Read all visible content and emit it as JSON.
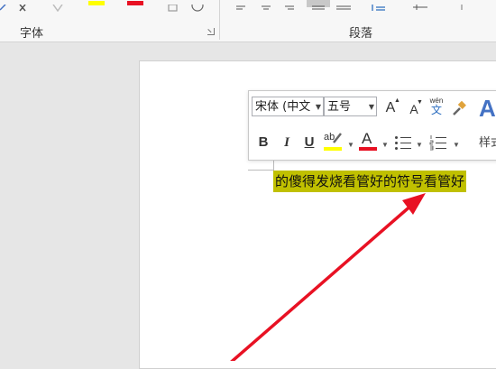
{
  "ribbon": {
    "font_group_label": "字体",
    "paragraph_group_label": "段落",
    "highlight_color": "#ffff00",
    "font_color": "#e81123"
  },
  "mini_toolbar": {
    "font_name": "宋体 (中文",
    "font_size": "五号",
    "grow_font_label": "A",
    "shrink_font_label": "A",
    "phonetic_top": "wén",
    "phonetic_bottom": "文",
    "styles_label": "样式",
    "bold_label": "B",
    "italic_label": "I",
    "underline_label": "U",
    "highlight_label": "ab",
    "font_color_label": "A",
    "highlight_color": "#ffff00",
    "font_color": "#e81123",
    "style_letter": "A"
  },
  "document": {
    "selected_text": "的傻得发烧看管好的符号看管好",
    "selection_color": "#c0c000"
  },
  "annotation": {
    "arrow_color": "#e81123"
  }
}
